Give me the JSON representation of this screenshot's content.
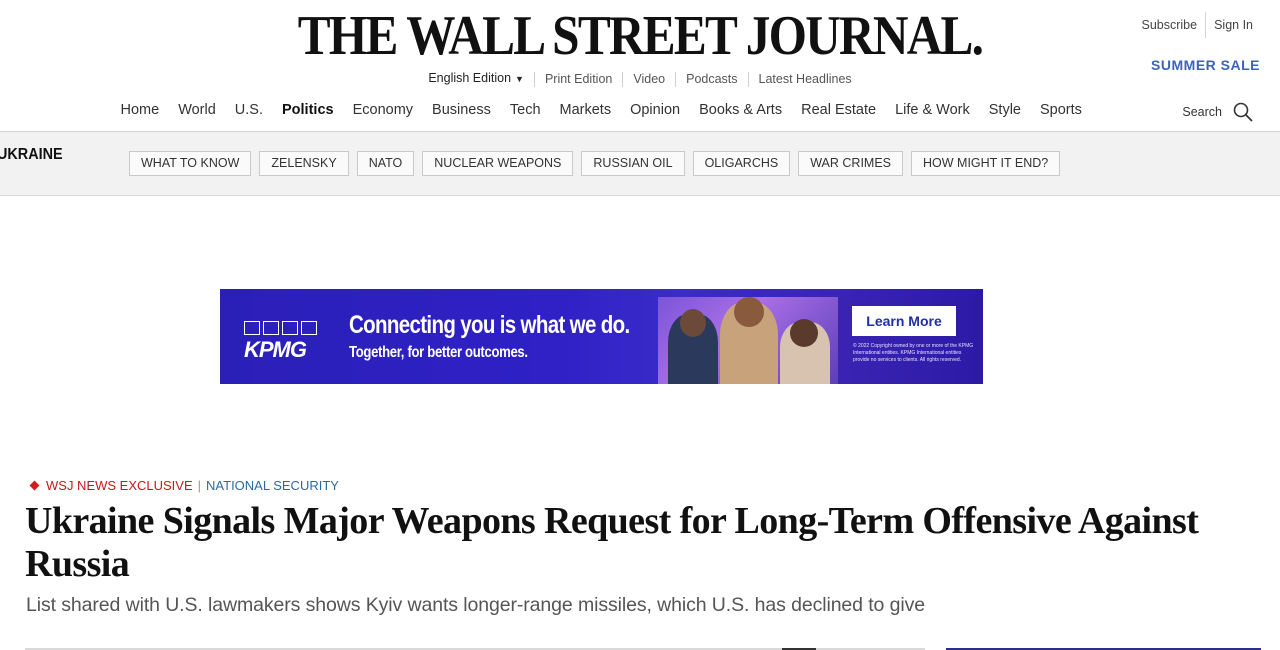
{
  "masthead": {
    "logo": "THE WALL STREET JOURNAL.",
    "edition": "English Edition",
    "links": [
      "Print Edition",
      "Video",
      "Podcasts",
      "Latest Headlines"
    ],
    "subscribe": "Subscribe",
    "sign_in": "Sign In",
    "promo": "SUMMER SALE"
  },
  "nav": {
    "sections": [
      "Home",
      "World",
      "U.S.",
      "Politics",
      "Economy",
      "Business",
      "Tech",
      "Markets",
      "Opinion",
      "Books & Arts",
      "Real Estate",
      "Life & Work",
      "Style",
      "Sports"
    ],
    "active": "Politics",
    "search_label": "Search"
  },
  "topic": {
    "title": "UKRAINE",
    "pills": [
      "WHAT TO KNOW",
      "ZELENSKY",
      "NATO",
      "NUCLEAR WEAPONS",
      "RUSSIAN OIL",
      "OLIGARCHS",
      "WAR CRIMES",
      "HOW MIGHT IT END?"
    ]
  },
  "ad": {
    "brand": "KPMG",
    "headline": "Connecting you is what we do.",
    "subline": "Together, for better outcomes.",
    "cta": "Learn More",
    "legal": "© 2022 Copyright owned by one or more of the KPMG International entities. KPMG International entities provide no services to clients. All rights reserved."
  },
  "article": {
    "flag": "WSJ NEWS EXCLUSIVE",
    "category": "NATIONAL SECURITY",
    "headline": "Ukraine Signals Major Weapons Request for Long-Term Offensive Against Russia",
    "dek": "List shared with U.S. lawmakers shows Kyiv wants longer-range missiles, which U.S. has declined to give"
  },
  "colors": {
    "promo_blue": "#3d63b8",
    "exclusive_red": "#c81818",
    "category_blue": "#2c6b9e",
    "topic_bar_bg": "#f2f2f2",
    "ad_bg": "#2f21c6"
  }
}
